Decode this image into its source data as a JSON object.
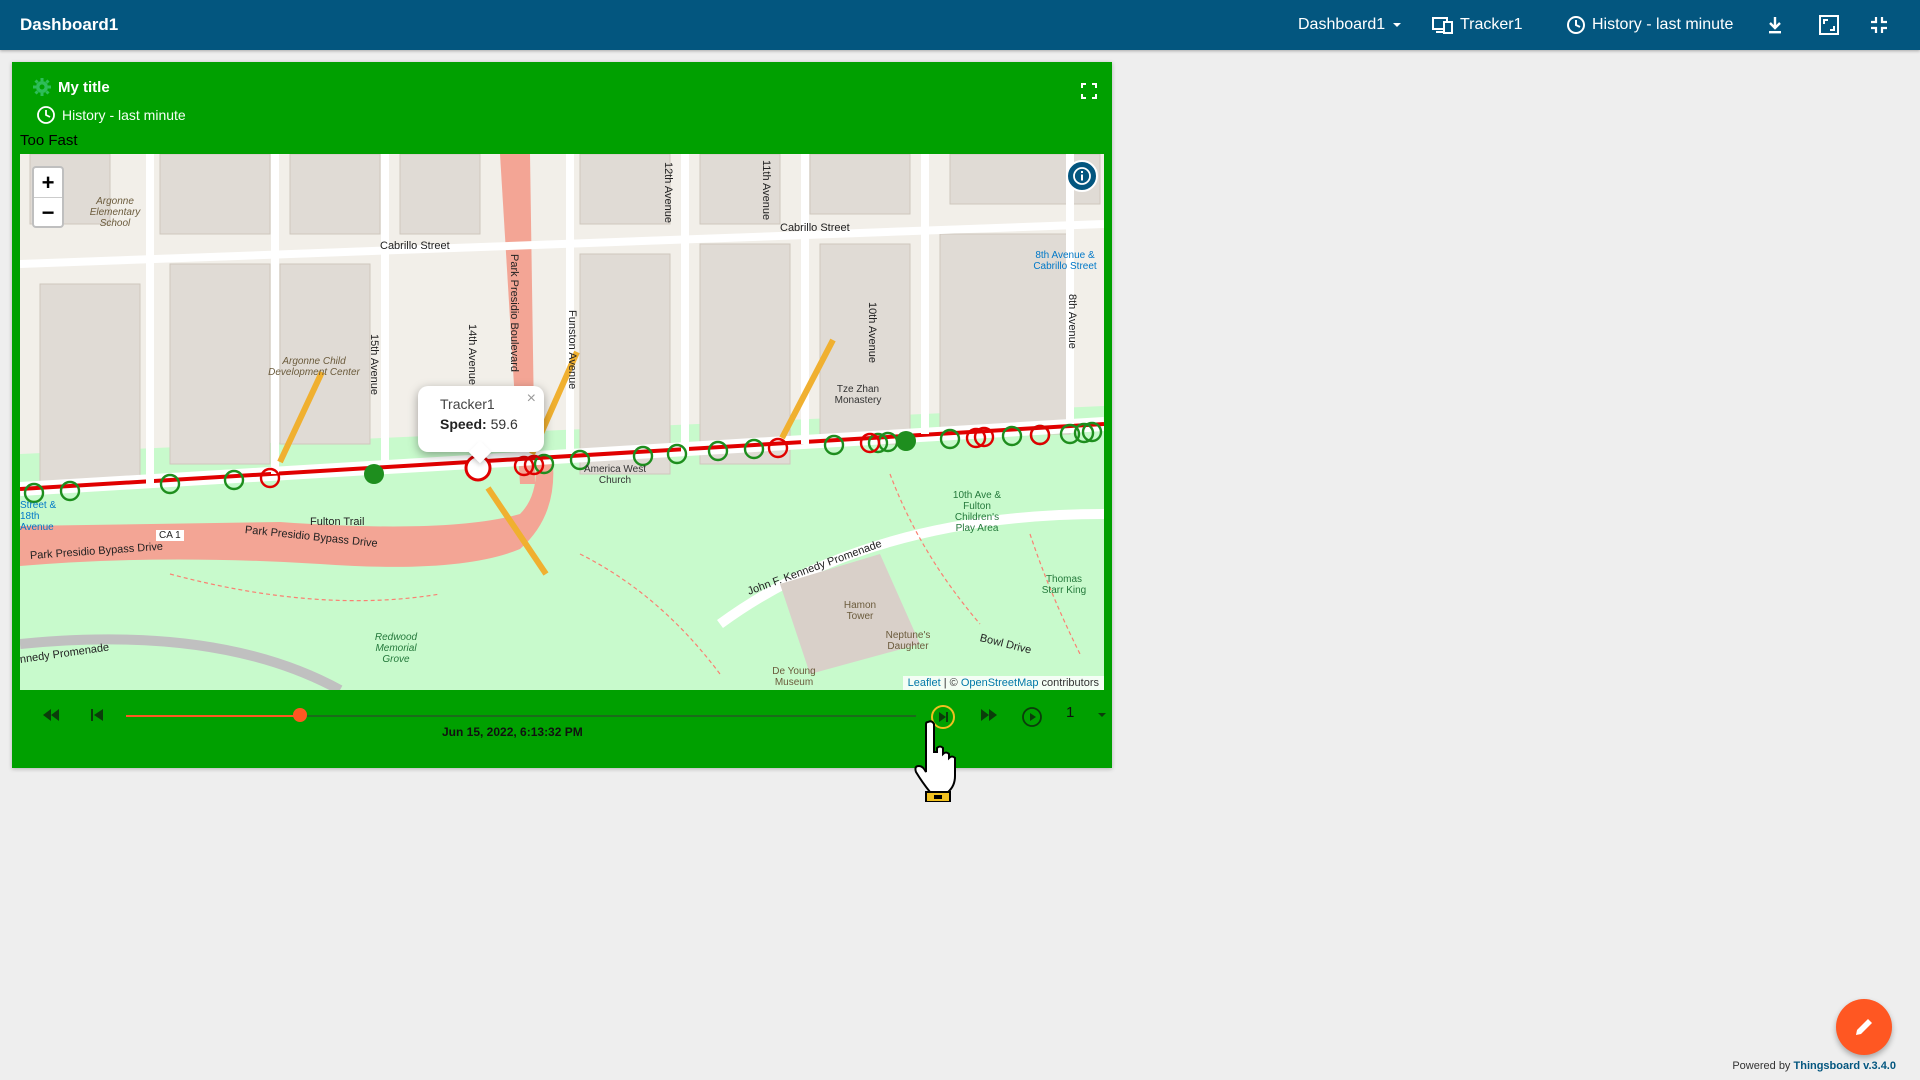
{
  "topbar": {
    "title": "Dashboard1",
    "dashboard_select": "Dashboard1",
    "entity": "Tracker1",
    "timewindow": "History - last minute",
    "icons": [
      "devices-icon",
      "clock-icon",
      "download-icon",
      "fullscreen-icon",
      "exit-fullscreen-icon"
    ]
  },
  "widget": {
    "title": "My title",
    "timewindow": "History - last minute",
    "label": "Too Fast",
    "popup": {
      "name": "Tracker1",
      "speed_label": "Speed:",
      "speed_value": "59.6",
      "close": "×"
    },
    "zoom": {
      "in": "+",
      "out": "−"
    },
    "attribution": {
      "leaflet": "Leaflet",
      "sep": " | © ",
      "osm": "OpenStreetMap",
      "suffix": " contributors"
    },
    "map_labels": {
      "cabrillo1": "Cabrillo Street",
      "cabrillo2": "Cabrillo Street",
      "park_presidio": "Park Presidio Boulevard",
      "bypass1": "Park Presidio Bypass Drive",
      "bypass2": "Park Presidio Bypass Drive",
      "fulton_trail": "Fulton Trail",
      "ca1": "CA 1",
      "ave15": "15th Avenue",
      "ave14": "14th Avenue",
      "ave12": "12th Avenue",
      "ave11": "11th Avenue",
      "ave10": "10th Avenue",
      "ave8": "8th Avenue",
      "funston": "Funston Avenue",
      "jfk": "John F. Kennedy Promenade",
      "kennedy": "nnedy Promenade",
      "bowl": "Bowl Drive",
      "argonne_school": "Argonne Elementary School",
      "argonne_child": "Argonne Child Development Center",
      "tze_zhan": "Tze Zhan Monastery",
      "america_west": "America West Church",
      "playarea": "10th Ave & Fulton Children's Play Area",
      "hamon": "Hamon Tower",
      "neptune": "Neptune's Daughter",
      "deyoung": "De Young Museum",
      "redwood": "Redwood Memorial Grove",
      "starr_king": "Thomas Starr King",
      "bus_8th": "8th Avenue & Cabrillo Street",
      "bus_18th": "Street & 18th Avenue"
    }
  },
  "playback": {
    "time": "Jun 15, 2022, 6:13:32 PM",
    "progress": 0.22,
    "speed": "1"
  },
  "footer": {
    "powered_by": "Powered by ",
    "link": "Thingsboard v.3.4.0"
  },
  "colors": {
    "toolbar": "#03567f",
    "widget_bg": "#00a000",
    "route": "#e00000",
    "marker_ok": "#1e8e1e",
    "marker_fast": "#e00000",
    "accent": "#ff5722"
  }
}
